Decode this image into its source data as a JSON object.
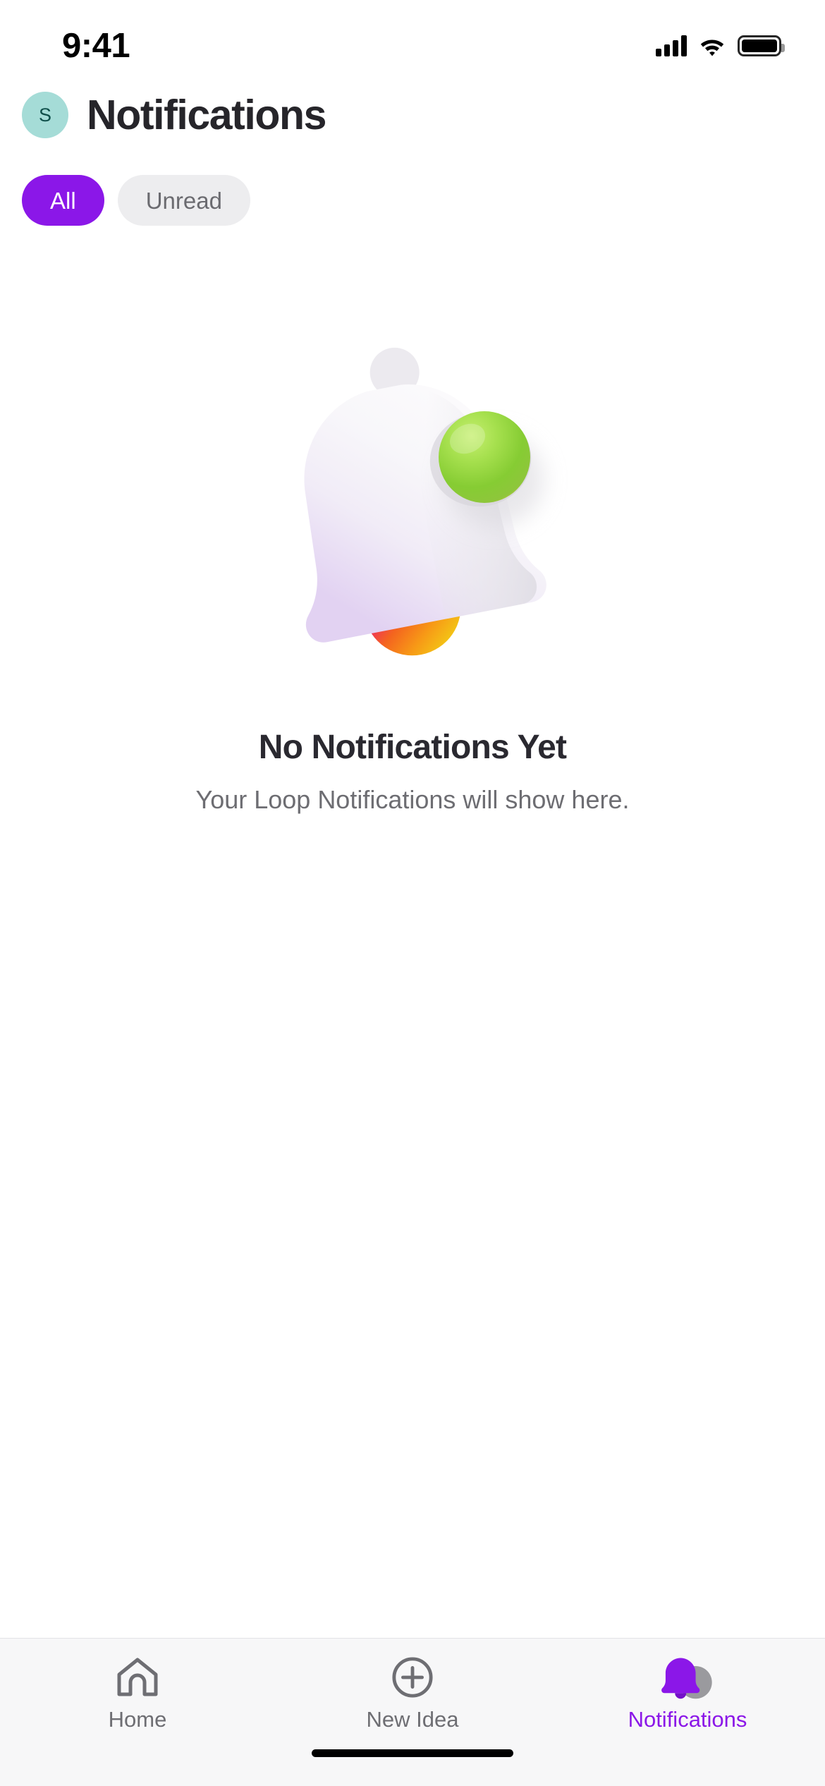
{
  "status_bar": {
    "time": "9:41",
    "signal_icon": "cellular-signal-icon",
    "wifi_icon": "wifi-icon",
    "battery_icon": "battery-full-icon"
  },
  "header": {
    "avatar_initial": "S",
    "avatar_color": "#a5dcd7",
    "avatar_text_color": "#0f4f4a",
    "title": "Notifications"
  },
  "filters": {
    "items": [
      {
        "label": "All",
        "active": true
      },
      {
        "label": "Unread",
        "active": false
      }
    ],
    "active_bg": "#8B17E8",
    "active_fg": "#ffffff",
    "inactive_bg": "#ededef",
    "inactive_fg": "#6b6b70"
  },
  "empty_state": {
    "illustration": "3d-bell-icon",
    "illustration_colors": {
      "bell_body_light": "#fbfafc",
      "bell_body_lavender": "#e4d5f2",
      "bell_shadow": "#e7e6ea",
      "sphere_green_light": "#a7e04f",
      "sphere_green": "#86cc33",
      "sphere_yellow": "#e8c547",
      "clapper_pink": "#ed1f86",
      "clapper_orange": "#f58220",
      "clapper_yellow": "#f4c020"
    },
    "title": "No Notifications Yet",
    "subtitle": "Your Loop Notifications will show here."
  },
  "tab_bar": {
    "active_color": "#8B17E8",
    "inactive_color": "#6e6e73",
    "tabs": [
      {
        "label": "Home",
        "icon": "home-icon",
        "active": false
      },
      {
        "label": "New Idea",
        "icon": "plus-circle-icon",
        "active": false
      },
      {
        "label": "Notifications",
        "icon": "bell-filled-icon",
        "active": true
      }
    ]
  },
  "home_indicator": "home-indicator-bar"
}
